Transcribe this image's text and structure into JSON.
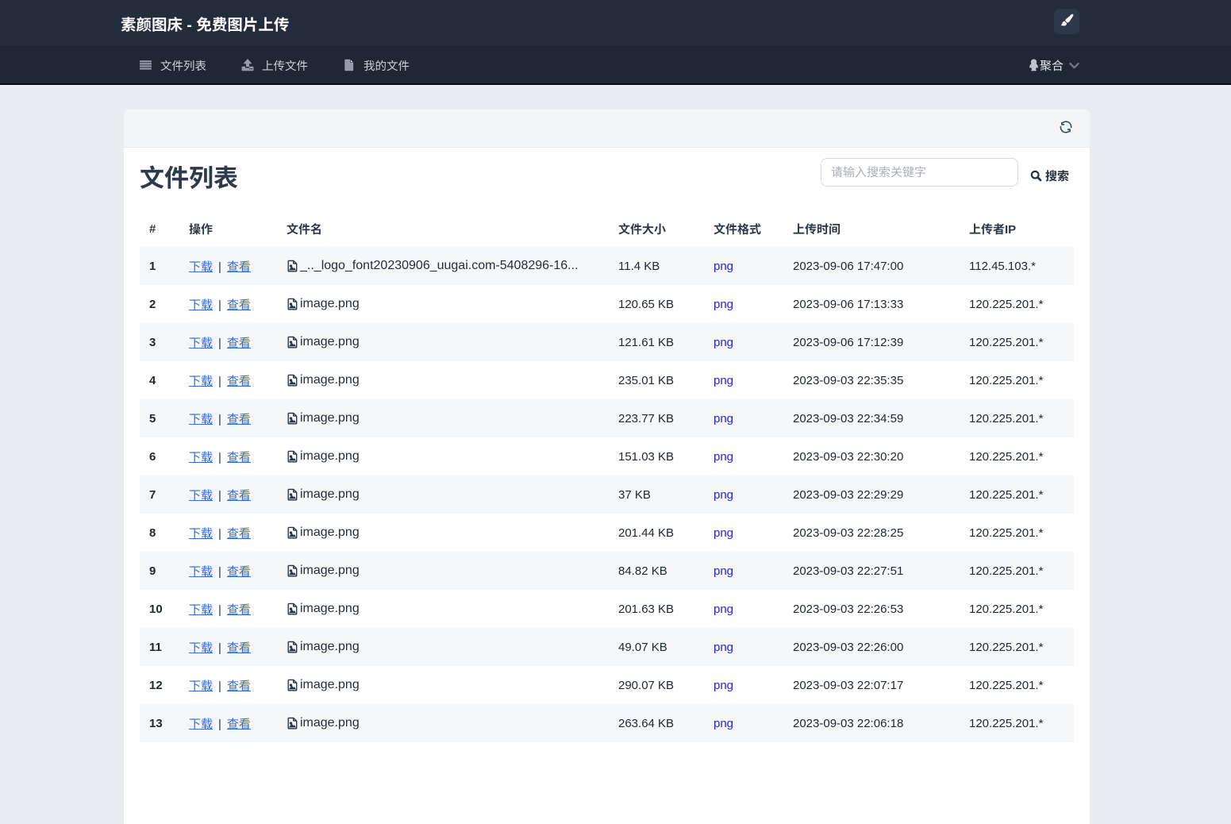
{
  "header": {
    "title": "素颜图床 - 免费图片上传",
    "theme_button_icon": "brush-icon"
  },
  "nav": {
    "items": [
      {
        "label": "文件列表",
        "icon": "list-icon"
      },
      {
        "label": "上传文件",
        "icon": "upload-icon"
      },
      {
        "label": "我的文件",
        "icon": "file-icon"
      }
    ],
    "user": {
      "label": "聚合",
      "icon": "qq-penguin-icon",
      "chevron": "chevron-down-icon"
    }
  },
  "card": {
    "refresh_icon": "refresh-icon",
    "title": "文件列表",
    "search": {
      "placeholder": "请输入搜索关键字",
      "button_label": "搜索",
      "button_icon": "search-icon"
    }
  },
  "table": {
    "columns": [
      "#",
      "操作",
      "文件名",
      "文件大小",
      "文件格式",
      "上传时间",
      "上传者IP"
    ],
    "actions": {
      "download": "下载",
      "separator": "|",
      "view": "查看"
    },
    "rows": [
      {
        "index": "1",
        "filename": "_.._logo_font20230906_uugai.com-5408296-16...",
        "size": "11.4 KB",
        "format": "png",
        "time": "2023-09-06 17:47:00",
        "ip": "112.45.103.*"
      },
      {
        "index": "2",
        "filename": "image.png",
        "size": "120.65 KB",
        "format": "png",
        "time": "2023-09-06 17:13:33",
        "ip": "120.225.201.*"
      },
      {
        "index": "3",
        "filename": "image.png",
        "size": "121.61 KB",
        "format": "png",
        "time": "2023-09-06 17:12:39",
        "ip": "120.225.201.*"
      },
      {
        "index": "4",
        "filename": "image.png",
        "size": "235.01 KB",
        "format": "png",
        "time": "2023-09-03 22:35:35",
        "ip": "120.225.201.*"
      },
      {
        "index": "5",
        "filename": "image.png",
        "size": "223.77 KB",
        "format": "png",
        "time": "2023-09-03 22:34:59",
        "ip": "120.225.201.*"
      },
      {
        "index": "6",
        "filename": "image.png",
        "size": "151.03 KB",
        "format": "png",
        "time": "2023-09-03 22:30:20",
        "ip": "120.225.201.*"
      },
      {
        "index": "7",
        "filename": "image.png",
        "size": "37 KB",
        "format": "png",
        "time": "2023-09-03 22:29:29",
        "ip": "120.225.201.*"
      },
      {
        "index": "8",
        "filename": "image.png",
        "size": "201.44 KB",
        "format": "png",
        "time": "2023-09-03 22:28:25",
        "ip": "120.225.201.*"
      },
      {
        "index": "9",
        "filename": "image.png",
        "size": "84.82 KB",
        "format": "png",
        "time": "2023-09-03 22:27:51",
        "ip": "120.225.201.*"
      },
      {
        "index": "10",
        "filename": "image.png",
        "size": "201.63 KB",
        "format": "png",
        "time": "2023-09-03 22:26:53",
        "ip": "120.225.201.*"
      },
      {
        "index": "11",
        "filename": "image.png",
        "size": "49.07 KB",
        "format": "png",
        "time": "2023-09-03 22:26:00",
        "ip": "120.225.201.*"
      },
      {
        "index": "12",
        "filename": "image.png",
        "size": "290.07 KB",
        "format": "png",
        "time": "2023-09-03 22:07:17",
        "ip": "120.225.201.*"
      },
      {
        "index": "13",
        "filename": "image.png",
        "size": "263.64 KB",
        "format": "png",
        "time": "2023-09-03 22:06:18",
        "ip": "120.225.201.*"
      }
    ]
  },
  "colors": {
    "topbar_bg": "#222c3a",
    "navbar_bg": "#1e2733",
    "page_bg": "#e9edf1",
    "link_blue": "#2e6be0",
    "format_blue": "#2424dd",
    "stripe": "#f5f7f9",
    "title_color": "#2d3a4b"
  }
}
